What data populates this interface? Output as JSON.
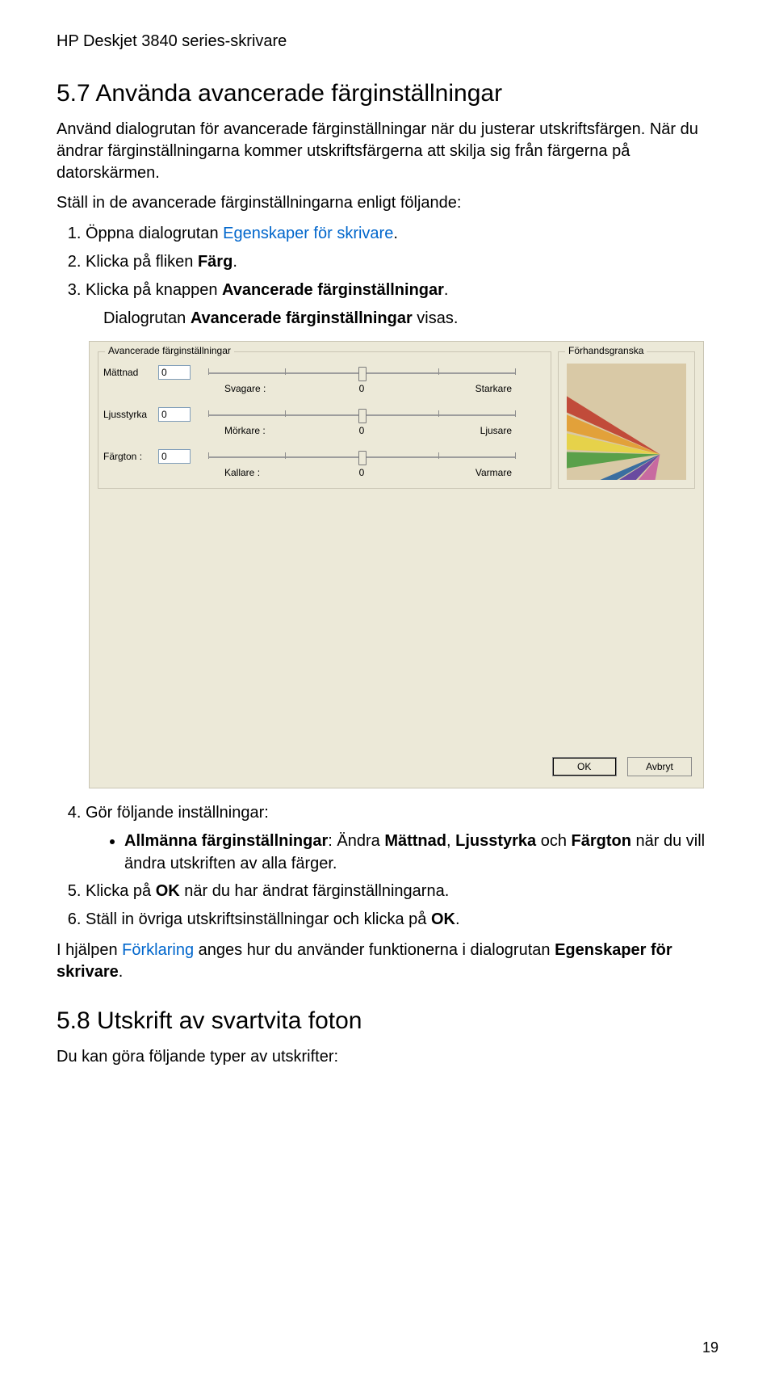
{
  "header": "HP Deskjet 3840 series-skrivare",
  "section_5_7": {
    "title": "5.7  Använda avancerade färginställningar",
    "p1": "Använd dialogrutan för avancerade färginställningar när du justerar utskriftsfärgen. När du ändrar färginställningarna kommer utskriftsfärgerna att skilja sig från färgerna på datorskärmen.",
    "p2": "Ställ in de avancerade färginställningarna enligt följande:",
    "steps_13": {
      "s1_a": "Öppna dialogrutan ",
      "s1_link": "Egenskaper för skrivare",
      "s1_b": ".",
      "s2_a": "Klicka på fliken ",
      "s2_bold": "Färg",
      "s2_b": ".",
      "s3_a": "Klicka på knappen ",
      "s3_bold": "Avancerade färginställningar",
      "s3_b": "."
    },
    "p3": {
      "a": "Dialogrutan ",
      "bold": "Avancerade färginställningar",
      "b": " visas."
    },
    "step4": "Gör följande inställningar:",
    "bullet4": {
      "bold1": "Allmänna färginställningar",
      "mid1": ": Ändra ",
      "bold2": "Mättnad",
      "mid2": ", ",
      "bold3": "Ljusstyrka",
      "mid3": " och ",
      "bold4": "Färgton",
      "mid4": " när du vill ändra utskriften av alla färger."
    },
    "step5": {
      "a": "Klicka på ",
      "bold": "OK",
      "b": " när du har ändrat färginställningarna."
    },
    "step6": {
      "a": "Ställ in övriga utskriftsinställningar och klicka på ",
      "bold": "OK",
      "b": "."
    },
    "p4": {
      "a": "I hjälpen ",
      "link": "Förklaring",
      "b": " anges hur du använder funktionerna i dialogrutan ",
      "bold": "Egenskaper för skrivare",
      "c": "."
    }
  },
  "dialog": {
    "group_main": "Avancerade färginställningar",
    "group_prev": "Förhandsgranska",
    "rows": [
      {
        "label": "Mättnad",
        "value": "0",
        "left": "Svagare :",
        "center": "0",
        "right": "Starkare"
      },
      {
        "label": "Ljusstyrka",
        "value": "0",
        "left": "Mörkare :",
        "center": "0",
        "right": "Ljusare"
      },
      {
        "label": "Färgton :",
        "value": "0",
        "left": "Kallare :",
        "center": "0",
        "right": "Varmare"
      }
    ],
    "btn_ok": "OK",
    "btn_cancel": "Avbryt"
  },
  "section_5_8": {
    "title": "5.8  Utskrift av svartvita foton",
    "p1": "Du kan göra följande typer av utskrifter:"
  },
  "page_number": "19"
}
